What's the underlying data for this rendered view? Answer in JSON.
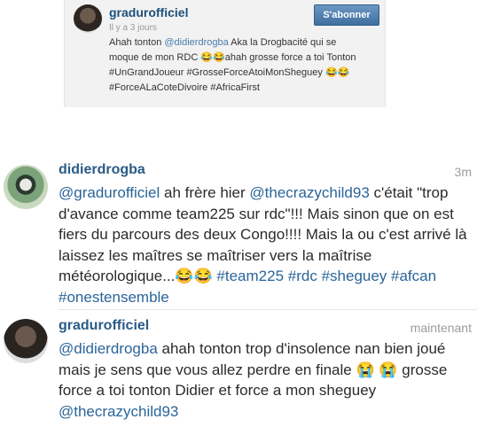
{
  "top_post": {
    "username": "gradurofficiel",
    "follow_label": "S'abonner",
    "timestamp": "Il y a 3 jours",
    "line1_prefix": "Ahah tonton ",
    "line1_mention": "@didierdrogba",
    "line1_suffix": " Aka la Drogbacité qui se",
    "line2": "moque de mon RDC 😂😂ahah grosse force a toi Tonton",
    "line3": "#UnGrandJoueur #GrosseForceAtoiMonSheguey 😂😂",
    "line4": "#ForceALaCoteDivoire #AfricaFirst"
  },
  "comments": [
    {
      "username": "didierdrogba",
      "time": "3m",
      "segments": [
        {
          "t": "@gradurofficiel",
          "tag": true
        },
        {
          "t": " ah frère hier ",
          "tag": false
        },
        {
          "t": "@thecrazychild93",
          "tag": true
        },
        {
          "t": " c'était \"trop d'avance comme team225 sur rdc\"!!! Mais sinon que on est fiers du parcours des deux Congo!!!! Mais la ou c'est arrivé là laissez les maîtres se maîtriser vers la maîtrise météorologique...😂😂 ",
          "tag": false
        },
        {
          "t": "#team225",
          "tag": true
        },
        {
          "t": " ",
          "tag": false
        },
        {
          "t": "#rdc #sheguey #afcan #onestensemble",
          "tag": true
        }
      ]
    },
    {
      "username": "gradurofficiel",
      "time": "maintenant",
      "segments": [
        {
          "t": "@didierdrogba",
          "tag": true
        },
        {
          "t": " ahah tonton trop d'insolence nan bien joué mais je sens que vous allez perdre en finale 😭 😭 grosse force a toi tonton Didier et force a mon sheguey ",
          "tag": false
        },
        {
          "t": "@thecrazychild93",
          "tag": true
        }
      ]
    }
  ]
}
